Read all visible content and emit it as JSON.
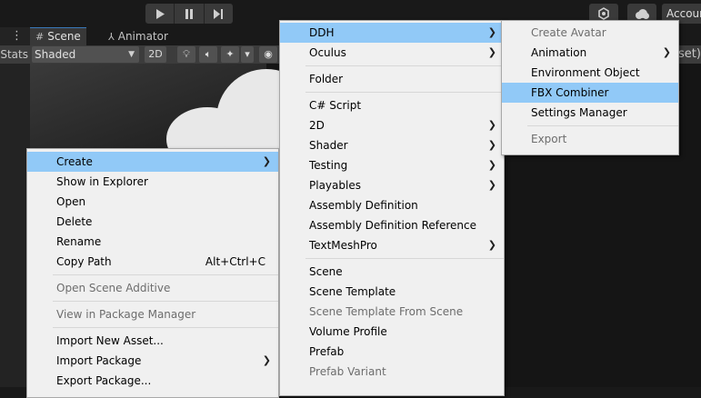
{
  "toolbar": {
    "play_icon": "play-icon",
    "pause_icon": "pause-icon",
    "step_icon": "step-icon",
    "account_label": "Account"
  },
  "left_panel": {
    "stats_label": "Stats"
  },
  "scene_tabs": {
    "scene_label": "Scene",
    "animator_label": "Animator"
  },
  "scene_toolbar": {
    "shading_mode": "Shaded",
    "mode_2d": "2D"
  },
  "right_panel": {
    "partial_text": "set)"
  },
  "context_menu": {
    "items": [
      {
        "label": "Create",
        "submenu": true,
        "selected": true
      },
      {
        "label": "Show in Explorer"
      },
      {
        "label": "Open"
      },
      {
        "label": "Delete"
      },
      {
        "label": "Rename"
      },
      {
        "label": "Copy Path",
        "shortcut": "Alt+Ctrl+C"
      },
      {
        "label": "Open Scene Additive",
        "disabled": true
      },
      {
        "label": "View in Package Manager",
        "disabled": true
      },
      {
        "label": "Import New Asset..."
      },
      {
        "label": "Import Package",
        "submenu": true
      },
      {
        "label": "Export Package..."
      }
    ]
  },
  "create_menu": {
    "items": [
      {
        "label": "DDH",
        "submenu": true,
        "selected": true
      },
      {
        "label": "Oculus",
        "submenu": true
      },
      {
        "label": "Folder"
      },
      {
        "label": "C# Script"
      },
      {
        "label": "2D",
        "submenu": true
      },
      {
        "label": "Shader",
        "submenu": true
      },
      {
        "label": "Testing",
        "submenu": true
      },
      {
        "label": "Playables",
        "submenu": true
      },
      {
        "label": "Assembly Definition"
      },
      {
        "label": "Assembly Definition Reference"
      },
      {
        "label": "TextMeshPro",
        "submenu": true
      },
      {
        "label": "Scene"
      },
      {
        "label": "Scene Template"
      },
      {
        "label": "Scene Template From Scene",
        "disabled": true
      },
      {
        "label": "Volume Profile"
      },
      {
        "label": "Prefab"
      },
      {
        "label": "Prefab Variant",
        "disabled": true
      }
    ]
  },
  "ddh_menu": {
    "items": [
      {
        "label": "Create Avatar",
        "disabled": true
      },
      {
        "label": "Animation",
        "submenu": true
      },
      {
        "label": "Environment Object"
      },
      {
        "label": "FBX Combiner",
        "selected": true
      },
      {
        "label": "Settings Manager"
      },
      {
        "label": "Export",
        "disabled": true
      }
    ]
  },
  "colors": {
    "menu_background": "#f0f0f0",
    "menu_highlight": "#91c9f7",
    "disabled_text": "#6d6d6d",
    "editor_dark": "#191919"
  }
}
